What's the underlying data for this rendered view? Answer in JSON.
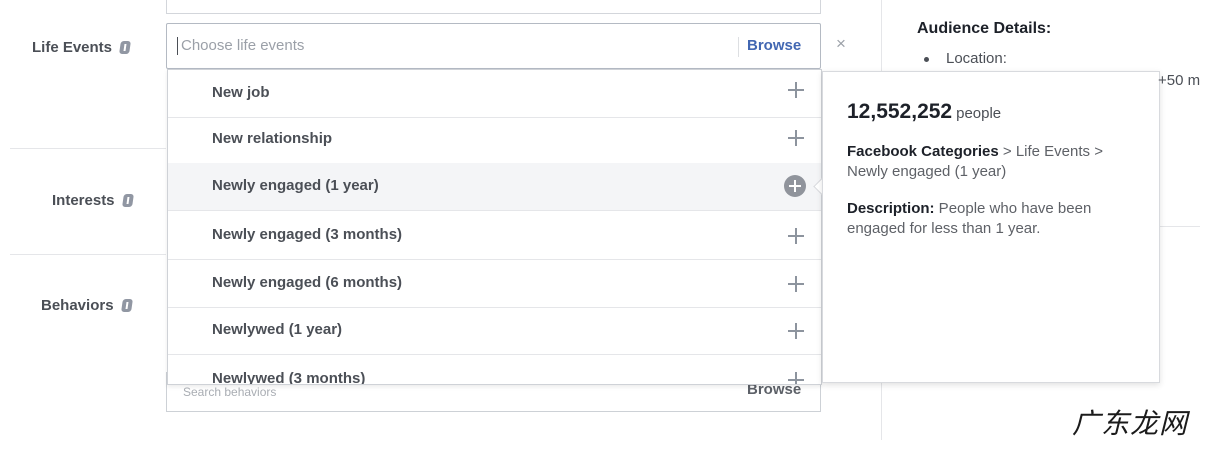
{
  "fields": {
    "life_events": {
      "label": "Life Events",
      "placeholder": "Choose life events",
      "browse": "Browse",
      "clear": "×"
    },
    "interests": {
      "label": "Interests"
    },
    "behaviors": {
      "label": "Behaviors",
      "placeholder": "Search behaviors",
      "browse": "Browse"
    }
  },
  "dropdown": {
    "items": [
      {
        "label": "New job"
      },
      {
        "label": "New relationship"
      },
      {
        "label": "Newly engaged (1 year)"
      },
      {
        "label": "Newly engaged (3 months)"
      },
      {
        "label": "Newly engaged (6 months)"
      },
      {
        "label": "Newlywed (1 year)"
      },
      {
        "label": "Newlywed (3 months)"
      }
    ],
    "active_index": 2
  },
  "tooltip": {
    "count": "12,552,252",
    "count_unit": "people",
    "category_label": "Facebook Categories",
    "category_path": " > Life Events > Newly engaged (1 year)",
    "description_label": "Description:",
    "description_text": " People who have been engaged for less than 1 year."
  },
  "audience": {
    "title": "Audience Details:",
    "location_label": "Location:",
    "radius": "+50 m"
  },
  "watermark": "广东龙网",
  "icons": [
    "info-icon",
    "close-icon",
    "plus-icon",
    "plus-circle-icon"
  ]
}
